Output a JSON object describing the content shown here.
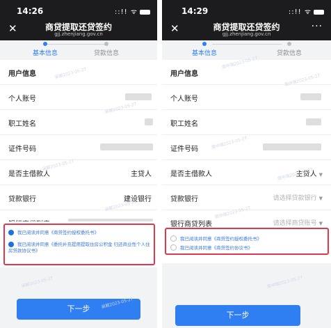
{
  "left": {
    "status_time": "14:26",
    "status_icons": "::!! ᯤ",
    "title": "商贷提取还贷签约",
    "subtitle": "gjj.zhenjiang.gov.cn",
    "steps": [
      "基本信息",
      "贷款信息"
    ],
    "section_title": "用户信息",
    "fields": [
      {
        "label": "个人账号",
        "value": ""
      },
      {
        "label": "职工姓名",
        "value": ""
      },
      {
        "label": "证件号码",
        "value": ""
      },
      {
        "label": "是否主借款人",
        "value": "主贷人"
      },
      {
        "label": "贷款银行",
        "value": "建设银行"
      },
      {
        "label": "银行商贷列表",
        "value": ""
      }
    ],
    "agreements": [
      "我已阅读并同意《商贷签约授权委托书》",
      "我已阅读并同意《委托补充提用提取住房公积金 归还商业性个人住房贷款协议书》"
    ],
    "button": "下一步",
    "watermark": "吴颖2023-05-27"
  },
  "right": {
    "status_time": "14:29",
    "status_icons": "::!! ᯤ",
    "title": "商贷提取还贷签约",
    "subtitle": "gjj.zhenjiang.gov.cn",
    "more": "···",
    "steps": [
      "基本信息",
      "贷款信息"
    ],
    "section_title": "用户信息",
    "fields": [
      {
        "label": "个人账号",
        "value": ""
      },
      {
        "label": "职工姓名",
        "value": ""
      },
      {
        "label": "证件号码",
        "value": ""
      },
      {
        "label": "是否主借款人",
        "value": "主贷人"
      },
      {
        "label": "贷款银行",
        "placeholder": "请选择贷款银行"
      },
      {
        "label": "银行商贷列表",
        "placeholder": "请选择商贷账号"
      }
    ],
    "agreements": [
      "我已阅读并同意《商贷签约授权委托书》",
      "我已阅读并同意《商贷签约协议书》"
    ],
    "button": "下一步",
    "watermark": "周中瑞2023-05-27"
  },
  "colors": {
    "accent": "#2f7ef2",
    "highlight_box": "#e0374b",
    "link": "#3a78d8",
    "checked": "#1e6fe0"
  }
}
